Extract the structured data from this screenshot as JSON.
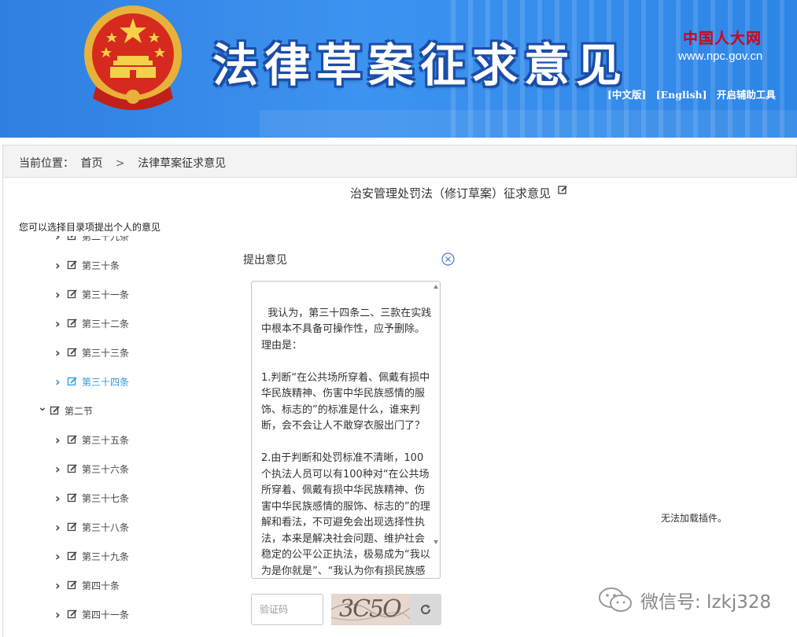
{
  "header": {
    "title": "法律草案征求意见",
    "site_logo": "中国人大网",
    "site_url": "www.npc.gov.cn",
    "lang_cn": "[中文版]",
    "lang_en": "[English]",
    "accessibility": "开启辅助工具",
    "colors": {
      "banner": "#3d93f0",
      "title_outline": "#1b4da8",
      "logo_red": "#d0021b"
    }
  },
  "breadcrumb": {
    "prefix": "当前位置：",
    "home": "首页",
    "separator": ">",
    "current": "法律草案征求意见"
  },
  "main": {
    "page_title": "治安管理处罚法（修订草案）征求意见",
    "hint": "您可以选择目录项提出个人的意见"
  },
  "tree": {
    "items": [
      {
        "label": "第二十九条",
        "level": 2,
        "state": "collapsed"
      },
      {
        "label": "第三十条",
        "level": 2,
        "state": "collapsed"
      },
      {
        "label": "第三十一条",
        "level": 2,
        "state": "collapsed"
      },
      {
        "label": "第三十二条",
        "level": 2,
        "state": "collapsed"
      },
      {
        "label": "第三十三条",
        "level": 2,
        "state": "collapsed"
      },
      {
        "label": "第三十四条",
        "level": 2,
        "state": "collapsed",
        "active": true
      },
      {
        "label": "第二节",
        "level": 1,
        "state": "expanded"
      },
      {
        "label": "第三十五条",
        "level": 2,
        "state": "collapsed"
      },
      {
        "label": "第三十六条",
        "level": 2,
        "state": "collapsed"
      },
      {
        "label": "第三十七条",
        "level": 2,
        "state": "collapsed"
      },
      {
        "label": "第三十八条",
        "level": 2,
        "state": "collapsed"
      },
      {
        "label": "第三十九条",
        "level": 2,
        "state": "collapsed"
      },
      {
        "label": "第四十条",
        "level": 2,
        "state": "collapsed"
      },
      {
        "label": "第四十一条",
        "level": 2,
        "state": "collapsed"
      }
    ],
    "active_color": "#3399dd"
  },
  "dialog": {
    "title": "提出意见",
    "opinion_text": "我认为，第三十四条二、三款在实践中根本不具备可操作性，应予删除。理由是：\n\n1.判断“在公共场所穿着、佩戴有损中华民族精神、伤害中华民族感情的服饰、标志的”的标准是什么，谁来判断，会不会让人不敢穿衣服出门了？\n\n2.由于判断和处罚标准不清晰，100个执法人员可以有100种对“在公共场所穿着、佩戴有损中华民族精神、伤害中华民族感情的服饰、标志的”的理解和看法，不可避免会出现选择性执法，本来是解决社会问题、维护社会稳定的公平公正执法，极易成为“我以为是你就是”、“我认为你有损民族感情你就是”",
    "captcha_placeholder": "验证码",
    "captcha_text": "3C5O"
  },
  "plugin_message": "无法加载插件。",
  "watermark": "微信号: lzkj328"
}
